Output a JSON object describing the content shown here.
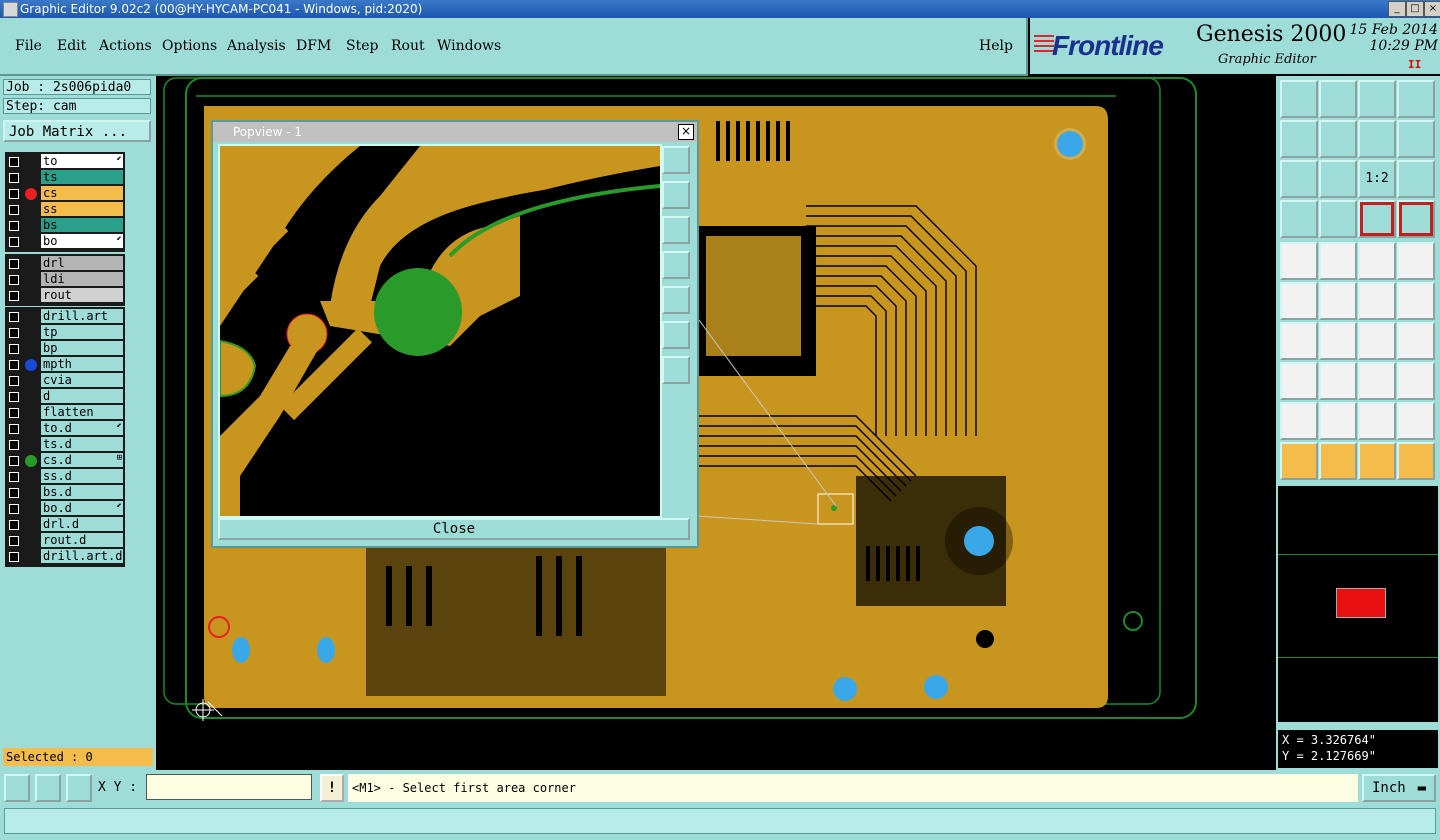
{
  "window": {
    "title": "Graphic Editor 9.02c2 (00@HY-HYCAM-PC041 - Windows, pid:2020)",
    "min": "_",
    "max": "□",
    "close": "×"
  },
  "menu": {
    "items": [
      "File",
      "Edit",
      "Actions",
      "Options",
      "Analysis",
      "DFM",
      "Step",
      "Rout",
      "Windows"
    ],
    "help": "Help"
  },
  "brand": {
    "logo": "Frontline",
    "product": "Genesis 2000",
    "subtitle": "Graphic Editor",
    "date": "15 Feb 2014",
    "time": "10:29 PM",
    "pause": "II"
  },
  "left": {
    "job": "Job : 2s006pida0",
    "step": "Step: cam",
    "job_matrix": "Job Matrix ...",
    "layers": [
      {
        "name": "to",
        "bg": "#ffffff",
        "dot": "",
        "mark": "⬋"
      },
      {
        "name": "ts",
        "bg": "#2aa08a",
        "dot": "",
        "mark": ""
      },
      {
        "name": "cs",
        "bg": "#f4bc4a",
        "dot": "#e82020",
        "mark": ""
      },
      {
        "name": "ss",
        "bg": "#f4bc4a",
        "dot": "",
        "mark": ""
      },
      {
        "name": "bs",
        "bg": "#2aa08a",
        "dot": "",
        "mark": ""
      },
      {
        "name": "bo",
        "bg": "#ffffff",
        "dot": "",
        "mark": "⬋"
      }
    ],
    "layers2": [
      {
        "name": "drl",
        "bg": "#b4b4b4"
      },
      {
        "name": "ldi",
        "bg": "#b4b4b4"
      },
      {
        "name": "rout",
        "bg": "#d0d0d0"
      }
    ],
    "layers3": [
      {
        "name": "drill.art",
        "dot": "",
        "mark": ""
      },
      {
        "name": "tp",
        "dot": "",
        "mark": ""
      },
      {
        "name": "bp",
        "dot": "",
        "mark": ""
      },
      {
        "name": "mpth",
        "dot": "#1a4ad8",
        "mark": ""
      },
      {
        "name": "cvia",
        "dot": "",
        "mark": ""
      },
      {
        "name": "d",
        "dot": "",
        "mark": ""
      },
      {
        "name": "flatten",
        "dot": "",
        "mark": ""
      },
      {
        "name": "to.d",
        "dot": "",
        "mark": "⬋"
      },
      {
        "name": "ts.d",
        "dot": "",
        "mark": ""
      },
      {
        "name": "cs.d",
        "dot": "#2a9a2a",
        "mark": "⊞"
      },
      {
        "name": "ss.d",
        "dot": "",
        "mark": ""
      },
      {
        "name": "bs.d",
        "dot": "",
        "mark": ""
      },
      {
        "name": "bo.d",
        "dot": "",
        "mark": "⬋"
      },
      {
        "name": "drl.d",
        "dot": "",
        "mark": ""
      },
      {
        "name": "rout.d",
        "dot": "",
        "mark": ""
      },
      {
        "name": "drill.art.d",
        "dot": "",
        "mark": ""
      }
    ],
    "selected": "Selected : 0"
  },
  "popup": {
    "title": "Popview - 1",
    "close_label": "Close",
    "close_x": "×"
  },
  "right": {
    "x": "X = 3.326764\"",
    "y": "Y = 2.127669\"",
    "scale": "1:2"
  },
  "bottom": {
    "xy_label": "X Y :",
    "xy_value": "",
    "warn": "!",
    "status": "<M1> - Select first area corner",
    "units": "Inch"
  },
  "colors": {
    "panel": "#9edcd8",
    "copper": "#c8961e",
    "outline": "#1c8a2a",
    "pad": "#3aa8e8"
  }
}
